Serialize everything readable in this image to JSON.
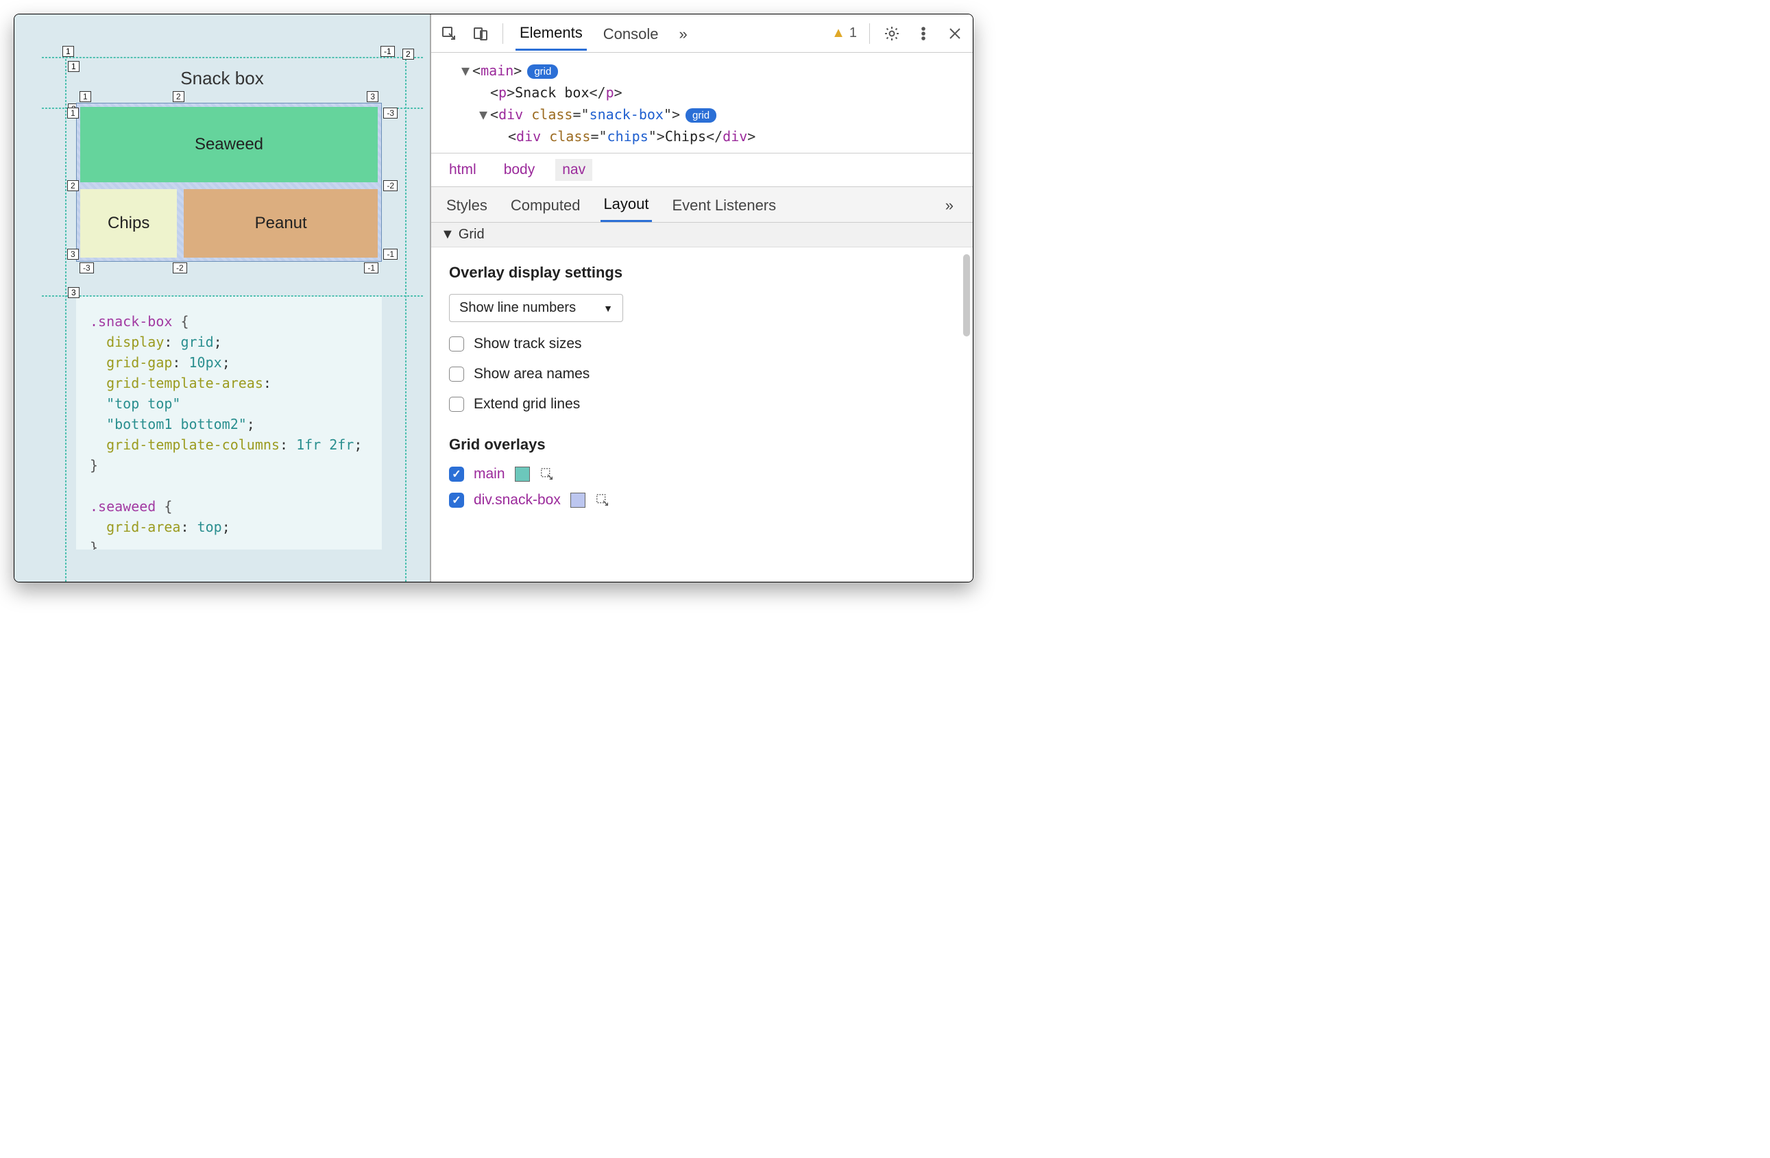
{
  "page": {
    "title": "Snack box",
    "snack_cells": {
      "seaweed": "Seaweed",
      "chips": "Chips",
      "peanut": "Peanut"
    },
    "outer_line_numbers": {
      "col": [
        "1",
        "-1",
        "2"
      ],
      "row": [
        "1",
        "2",
        "3"
      ]
    },
    "inner_line_numbers": {
      "top": [
        "1",
        "2",
        "3"
      ],
      "top_neg": "-3",
      "row2": [
        "2",
        "-2"
      ],
      "row3": [
        "3",
        "-1"
      ],
      "bot_neg": [
        "-3",
        "-2",
        "-1"
      ],
      "left_top": "1"
    },
    "code": ".snack-box {\n  display: grid;\n  grid-gap: 10px;\n  grid-template-areas:\n  \"top top\"\n  \"bottom1 bottom2\";\n  grid-template-columns: 1fr 2fr;\n}\n\n.seaweed {\n  grid-area: top;\n}"
  },
  "devtools": {
    "toolbar": {
      "tabs": [
        "Elements",
        "Console"
      ],
      "active_tab": "Elements",
      "more": "»",
      "warning_count": "1"
    },
    "dom": {
      "line1_tag": "main",
      "line1_badge": "grid",
      "line2_tag": "p",
      "line2_text": "Snack box",
      "line3_tag": "div",
      "line3_attr": "class",
      "line3_val": "snack-box",
      "line3_badge": "grid",
      "line4_tag": "div",
      "line4_attr": "class",
      "line4_val": "chips",
      "line4_text": "Chips"
    },
    "breadcrumbs": [
      "html",
      "body",
      "nav"
    ],
    "breadcrumb_selected": "nav",
    "subtabs": [
      "Styles",
      "Computed",
      "Layout",
      "Event Listeners"
    ],
    "subtab_active": "Layout",
    "subtab_more": "»",
    "grid_section": "Grid",
    "overlay_settings": {
      "heading": "Overlay display settings",
      "select": "Show line numbers",
      "options": [
        {
          "label": "Show track sizes",
          "checked": false
        },
        {
          "label": "Show area names",
          "checked": false
        },
        {
          "label": "Extend grid lines",
          "checked": false
        }
      ]
    },
    "grid_overlays": {
      "heading": "Grid overlays",
      "items": [
        {
          "name": "main",
          "checked": true,
          "swatch": "teal"
        },
        {
          "name": "div.snack-box",
          "checked": true,
          "swatch": "lav"
        }
      ]
    }
  }
}
